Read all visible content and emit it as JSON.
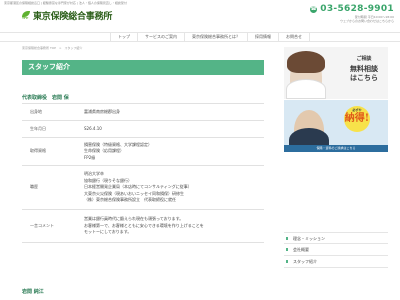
{
  "header": {
    "tagline": "東京都港区の保険相談窓口 | 経験豊富な専門家が対応 | 法人・個人の保険見直し・相談受付",
    "logo_mark": "TFP",
    "logo_text": "東京保険総合事務所",
    "phone": "03-5628-9901",
    "hours_line1": "受付時間 平日10:00〜18:00",
    "hours_line2": "ウェブからのお問い合わせはこちらから"
  },
  "nav": [
    "トップ",
    "サービスのご案内",
    "東京保険総合事務所とは？",
    "採用情報",
    "お問合せ"
  ],
  "breadcrumb": {
    "home": "東京保険総合事務所 TOP",
    "sep": ">",
    "current": "スタッフ紹介"
  },
  "page_title": "スタッフ紹介",
  "section1": {
    "heading": "代表取締役　岩間 保",
    "rows": [
      {
        "label": "出身地",
        "value": "富浦県南房総郡出身"
      },
      {
        "label": "生年月日",
        "value": "S26.4.10"
      },
      {
        "label": "取得資格",
        "value": "損害保険（特級資格、大学課程認定）\n生命保険（応用課程）\nFP2級"
      },
      {
        "label": "職歴",
        "value": "明治大学卒\n協和銀行（現りそな銀行）\n日本経営開発企業局（本店時にてコンサルティングに従事）\n大東京火災保険（現あいおいニッセイ同和損保）研修生\n（株）東京総合保険事務所設立　代表取締役に就任"
      },
      {
        "label": "一言コメント",
        "value": "営業は銀行員時代に鍛えられ現在も頑張っております。\nお客様第一で、お客様とともに安心できる環境を作り上げることを\nモットーにしております。"
      }
    ]
  },
  "section2": {
    "heading": "岩間 純江"
  },
  "banner1": {
    "small": "ご相談",
    "main": "無料相談\nはこちら"
  },
  "banner2": {
    "badge_small": "必ずや",
    "badge_main": "納得!",
    "bottom": "保険・資料のご請求はこちら"
  },
  "side_menu": [
    "理念・ミッション",
    "会社概要",
    "スタッフ紹介"
  ],
  "colors": {
    "accent": "#54b487",
    "logo_green": "#5fb230",
    "phone_green": "#3aa56b"
  }
}
